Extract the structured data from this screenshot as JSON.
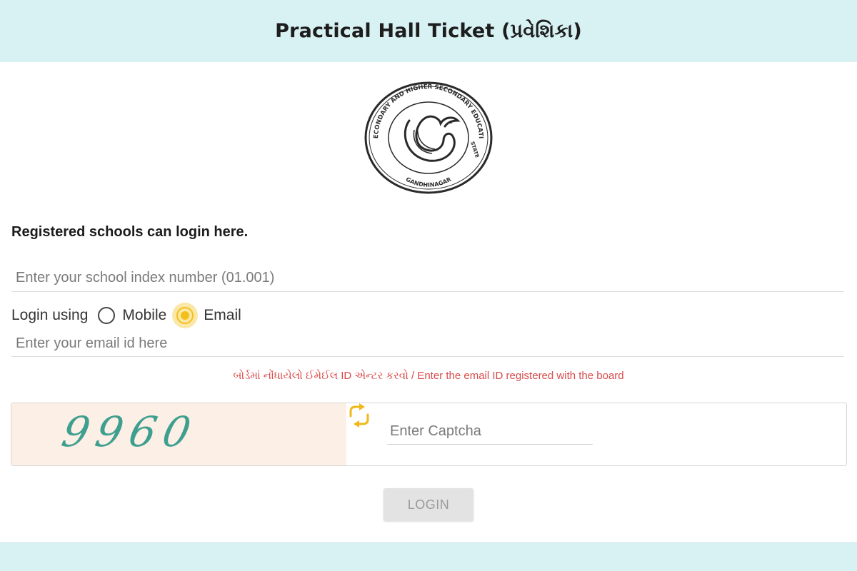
{
  "header": {
    "title": "Practical Hall Ticket (પ્રવેશિકા)"
  },
  "logo": {
    "seal_text": "GUJARAT SECONDARY AND HIGHER SECONDARY EDUCATION BOARD",
    "state_text": "STATE",
    "city_text": "GANDHINAGAR"
  },
  "form": {
    "heading": "Registered schools can login here.",
    "school_index": {
      "value": "",
      "placeholder": "Enter your school index number (01.001)"
    },
    "login_using": {
      "label": "Login using",
      "options": [
        "Mobile",
        "Email"
      ],
      "selected": "Email"
    },
    "email": {
      "value": "",
      "placeholder": "Enter your email id here"
    },
    "hint": "બોર્ડમાં નોંધાયેલો ઈમેઈલ ID એન્ટર કરવો / Enter the email ID registered with the board",
    "captcha": {
      "image_text": "9960",
      "refresh_icon": "refresh-arrows-icon",
      "input": {
        "value": "",
        "placeholder": "Enter Captcha"
      }
    },
    "login_button": "LOGIN"
  },
  "colors": {
    "header_bg": "#d8f1f3",
    "hint_red": "#d94a4a",
    "radio_selected": "#f3c01a",
    "captcha_bg": "#fbefe6",
    "captcha_text": "#3f9f8f"
  }
}
